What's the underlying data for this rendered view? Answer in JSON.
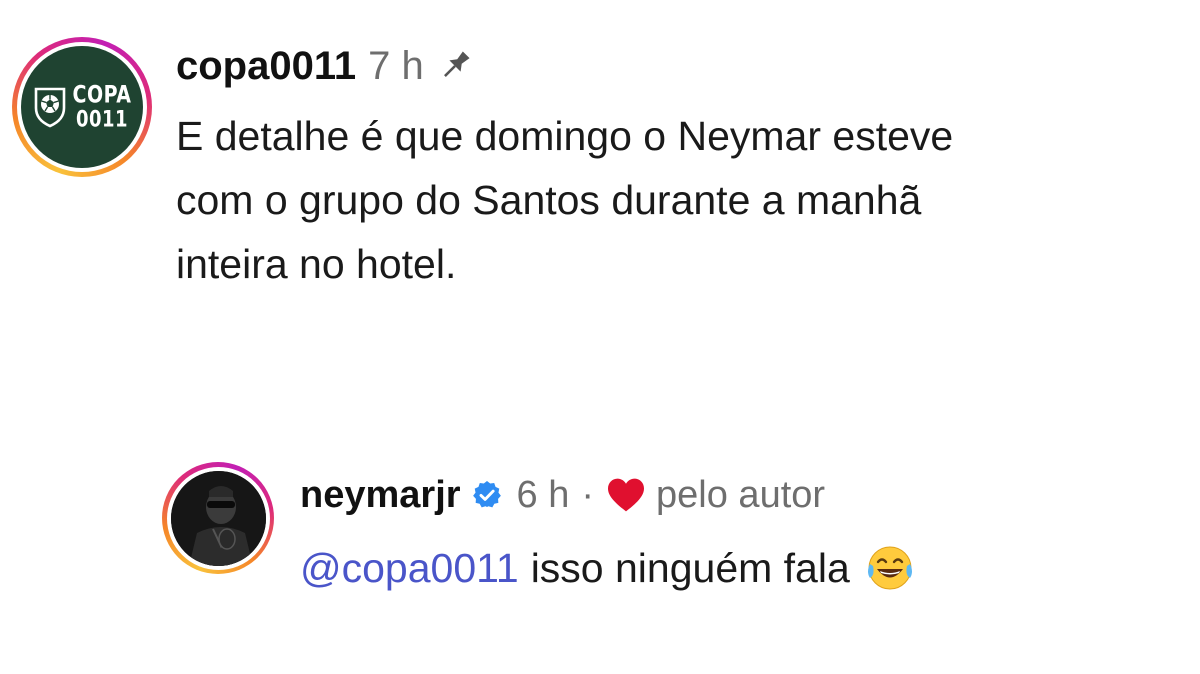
{
  "comments": [
    {
      "username": "copa0011",
      "time": "7 h",
      "pinned": true,
      "avatar": {
        "logo_line1": "COPA",
        "logo_line2": "0011",
        "bg_color": "#1f4331",
        "icons": [
          "soccer-ball-icon",
          "shield-icon"
        ]
      },
      "text": "E detalhe é que domingo o Neymar esteve\ncom o grupo do Santos durante a manhã\ninteira no hotel."
    },
    {
      "username": "neymarjr",
      "verified": true,
      "time": "6 h",
      "separator": "·",
      "liked_by_author_label": "pelo autor",
      "heart_color": "#e0102f",
      "mention": "@copa0011",
      "text": "isso ninguém fala",
      "emoji": "face-with-tears-of-joy-icon"
    }
  ],
  "colors": {
    "mention": "#4a55c9",
    "muted": "#6e6e6e",
    "verified": "#2f8cf2"
  }
}
